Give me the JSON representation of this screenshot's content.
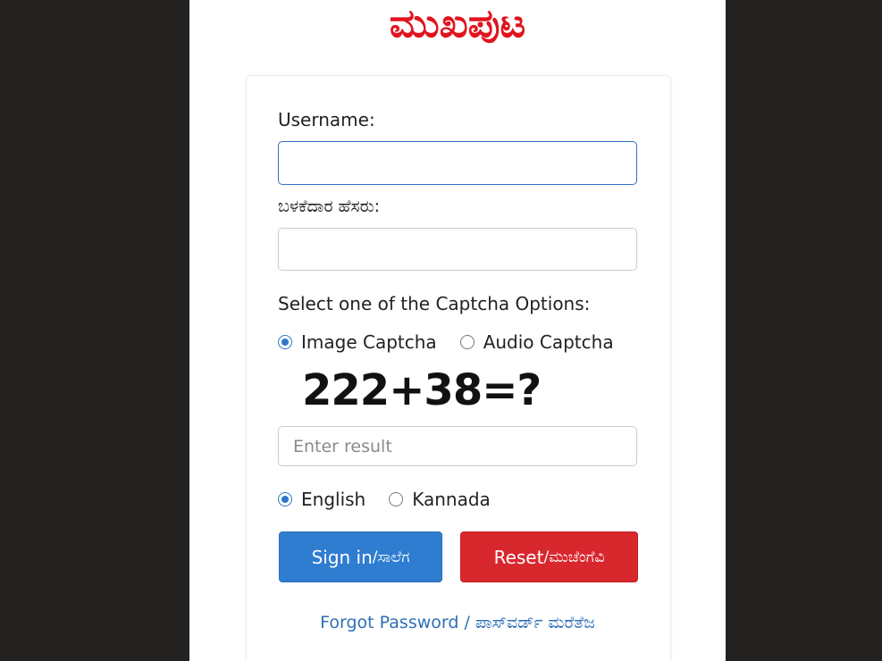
{
  "brand": {
    "title": "ಮುಖಪುಟ",
    "color": "#e0141e"
  },
  "form": {
    "username_label": "Username:",
    "username_value": "",
    "password_label": "ಬಳಕೆದಾರ ಹೆಸರು:",
    "password_value": "",
    "captcha_options_label": "Select one of the Captcha Options:",
    "captcha_options": [
      {
        "label": "Image Captcha",
        "selected": true
      },
      {
        "label": "Audio Captcha",
        "selected": false
      }
    ],
    "captcha_text": "222+38=?",
    "result_placeholder": "Enter result",
    "result_value": "",
    "languages": [
      {
        "label": "English",
        "selected": true
      },
      {
        "label": "Kannada",
        "selected": false
      }
    ]
  },
  "buttons": {
    "signin_main": "Sign in",
    "signin_kn": " /ಸಾಲೆಗ",
    "signin_color": "#2f7dd0",
    "reset_main": "Reset",
    "reset_kn": " /ಮುಚೆಂಗೆವಿ",
    "reset_color": "#d9272e"
  },
  "links": {
    "forgot_password": "Forgot Password / ಪಾಸ್‌ವರ್ಡ್ ಮರೆತೆಜ"
  }
}
